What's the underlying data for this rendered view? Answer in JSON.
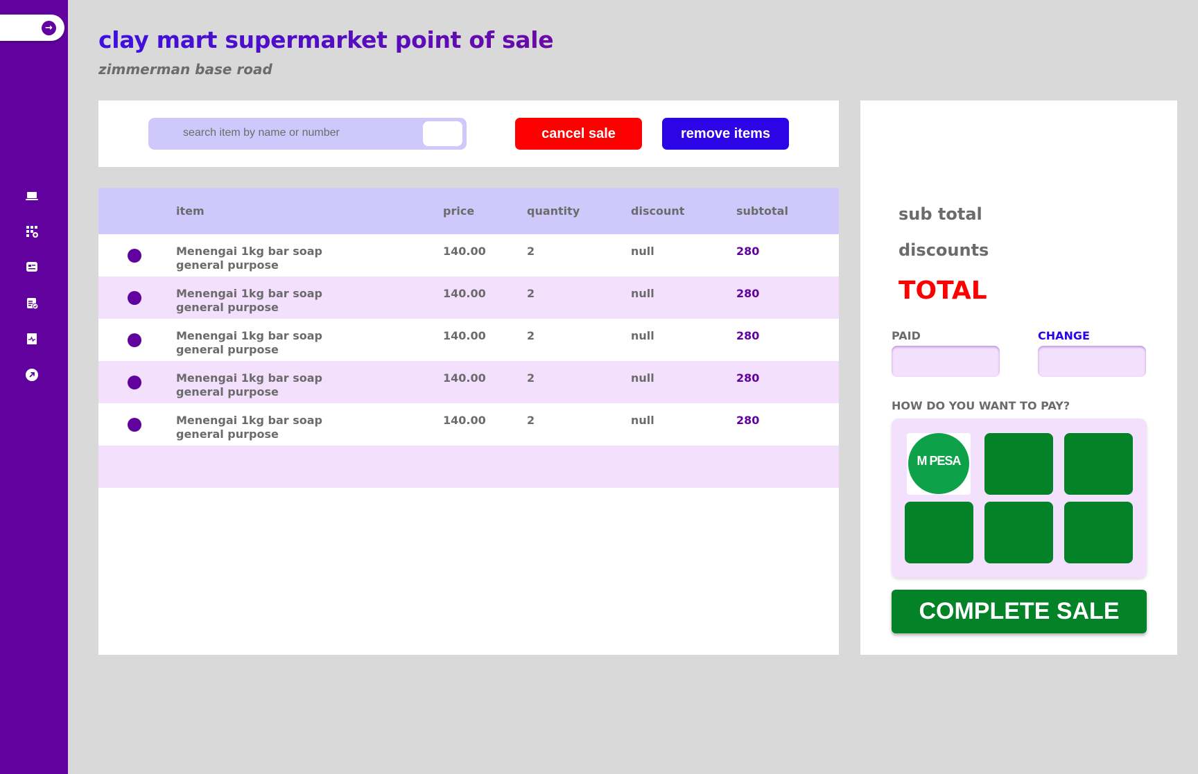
{
  "header": {
    "title": "clay mart supermarket point of sale",
    "subtitle": "zimmerman base road"
  },
  "sidebar": {
    "toggle_icon": "arrow-right-icon",
    "items": [
      {
        "icon": "laptop-icon"
      },
      {
        "icon": "grid-add-icon"
      },
      {
        "icon": "card-icon"
      },
      {
        "icon": "calendar-check-icon"
      },
      {
        "icon": "chart-icon"
      },
      {
        "icon": "arrow-up-right-icon"
      }
    ]
  },
  "toolbar": {
    "search_placeholder": "search item by name or number",
    "cancel_label": "cancel sale",
    "remove_label": "remove items"
  },
  "table": {
    "columns": [
      "item",
      "price",
      "quantity",
      "discount",
      "subtotal"
    ],
    "rows": [
      {
        "item": "Menengai 1kg bar soap general purpose",
        "price": "140.00",
        "quantity": "2",
        "discount": "null",
        "subtotal": "280"
      },
      {
        "item": "Menengai 1kg bar soap general purpose",
        "price": "140.00",
        "quantity": "2",
        "discount": "null",
        "subtotal": "280"
      },
      {
        "item": "Menengai 1kg bar soap general purpose",
        "price": "140.00",
        "quantity": "2",
        "discount": "null",
        "subtotal": "280"
      },
      {
        "item": "Menengai 1kg bar soap general purpose",
        "price": "140.00",
        "quantity": "2",
        "discount": "null",
        "subtotal": "280"
      },
      {
        "item": "Menengai 1kg bar soap general purpose",
        "price": "140.00",
        "quantity": "2",
        "discount": "null",
        "subtotal": "280"
      }
    ]
  },
  "summary": {
    "subtotal_label": "sub total",
    "discounts_label": "discounts",
    "total_label": "TOTAL",
    "paid_label": "PAID",
    "change_label": "CHANGE",
    "paid_value": "",
    "change_value": "",
    "pay_question": "HOW DO YOU WANT TO PAY?",
    "mpesa_text": "M PESA",
    "complete_label": "COMPLETE SALE"
  },
  "colors": {
    "brand_purple": "#62029e",
    "accent_blue": "#2c05e6",
    "danger_red": "#ff0000",
    "pay_green": "#038228",
    "table_header": "#cfc9fb",
    "row_alt": "#f3e0fd"
  }
}
